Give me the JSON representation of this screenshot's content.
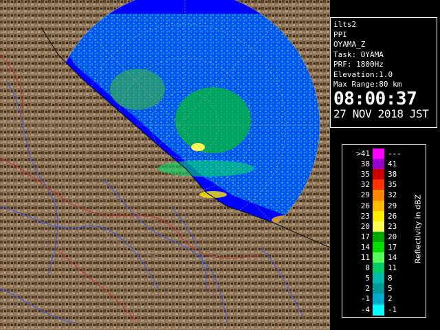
{
  "info": {
    "product": "ilts2",
    "scan_type": "PPI",
    "field": "OYAMA_Z",
    "task": "Task: OYAMA",
    "prf": "PRF: 1800Hz",
    "elevation": "Elevation:1.0",
    "max_range": "Max Range:80 km",
    "time": "08:00:37",
    "date": "27 NOV 2018 JST"
  },
  "legend": {
    "title": "Reflectivity in dBZ",
    "rows": [
      {
        "left": ">41",
        "right": "---",
        "color": "#ff00ff"
      },
      {
        "left": "38",
        "right": "41",
        "color": "#9900cc"
      },
      {
        "left": "35",
        "right": "38",
        "color": "#cc0000"
      },
      {
        "left": "32",
        "right": "35",
        "color": "#ff3300"
      },
      {
        "left": "29",
        "right": "32",
        "color": "#ff8800"
      },
      {
        "left": "26",
        "right": "29",
        "color": "#ffbb00"
      },
      {
        "left": "23",
        "right": "26",
        "color": "#ffee00"
      },
      {
        "left": "20",
        "right": "23",
        "color": "#ffff55"
      },
      {
        "left": "17",
        "right": "20",
        "color": "#00aa00"
      },
      {
        "left": "14",
        "right": "17",
        "color": "#00dd00"
      },
      {
        "left": "11",
        "right": "14",
        "color": "#55ff55"
      },
      {
        "left": "8",
        "right": "11",
        "color": "#00cc66"
      },
      {
        "left": "5",
        "right": "8",
        "color": "#00bbaa"
      },
      {
        "left": "2",
        "right": "5",
        "color": "#009999"
      },
      {
        "left": "-1",
        "right": "2",
        "color": "#00aacc"
      },
      {
        "left": "-4",
        "right": "-1",
        "color": "#00ffff"
      }
    ]
  },
  "colors": {
    "sea": "#0000ff",
    "land": "#8b7155",
    "range_ring": "#888888",
    "river": "#3355ff",
    "border": "#cc2222"
  }
}
